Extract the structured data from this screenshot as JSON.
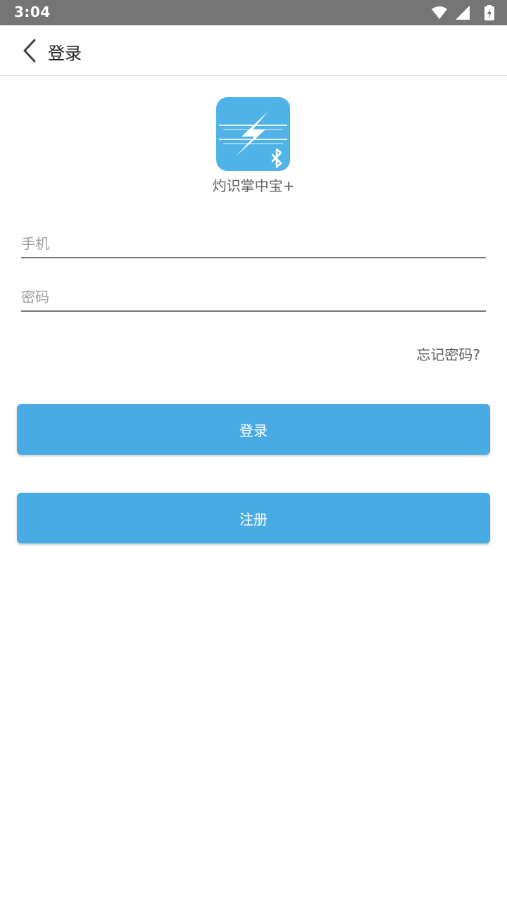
{
  "status_bar": {
    "time": "3:04",
    "icons": [
      "wifi-icon",
      "cell-signal-icon",
      "battery-charging-icon"
    ]
  },
  "app_bar": {
    "back_icon": "chevron-left-icon",
    "title": "登录"
  },
  "logo": {
    "icon": "lightning-bluetooth-logo",
    "color": "#4fb3e8",
    "app_name": "灼识掌中宝+"
  },
  "form": {
    "phone_placeholder": "手机",
    "phone_value": "",
    "password_placeholder": "密码",
    "password_value": "",
    "forgot_password": "忘记密码?"
  },
  "buttons": {
    "login": "登录",
    "register": "注册"
  },
  "colors": {
    "status_bar": "#757575",
    "primary": "#49abe3"
  }
}
